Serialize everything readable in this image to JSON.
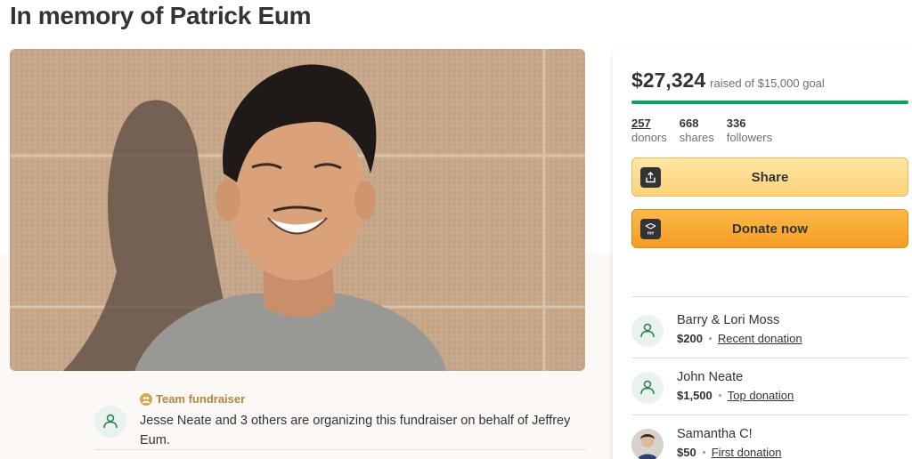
{
  "page": {
    "title": "In memory of Patrick Eum"
  },
  "hero": {
    "image_alt": "Photo of a smiling young man against a stone wall"
  },
  "organizer": {
    "team_label": "Team fundraiser",
    "text": "Jesse Neate and 3 others are organizing this fundraiser on behalf of Jeffrey Eum."
  },
  "card": {
    "raised_amount": "$27,324",
    "raised_goal": "raised of $15,000 goal",
    "progress_fraction": 1.0,
    "stats": [
      {
        "number": "257",
        "label": "donors"
      },
      {
        "number": "668",
        "label": "shares"
      },
      {
        "number": "336",
        "label": "followers"
      }
    ],
    "share_label": "Share",
    "donate_label": "Donate now",
    "donations": [
      {
        "name": "Barry & Lori Moss",
        "amount": "$200",
        "tag": "Recent donation"
      },
      {
        "name": "John Neate",
        "amount": "$1,500",
        "tag": "Top donation"
      },
      {
        "name": "Samantha C!",
        "amount": "$50",
        "tag": "First donation"
      }
    ]
  },
  "colors": {
    "progress": "#02a95c",
    "share_button": "#fcd27a",
    "donate_button": "#f49c21",
    "team_accent": "#b3863d"
  }
}
